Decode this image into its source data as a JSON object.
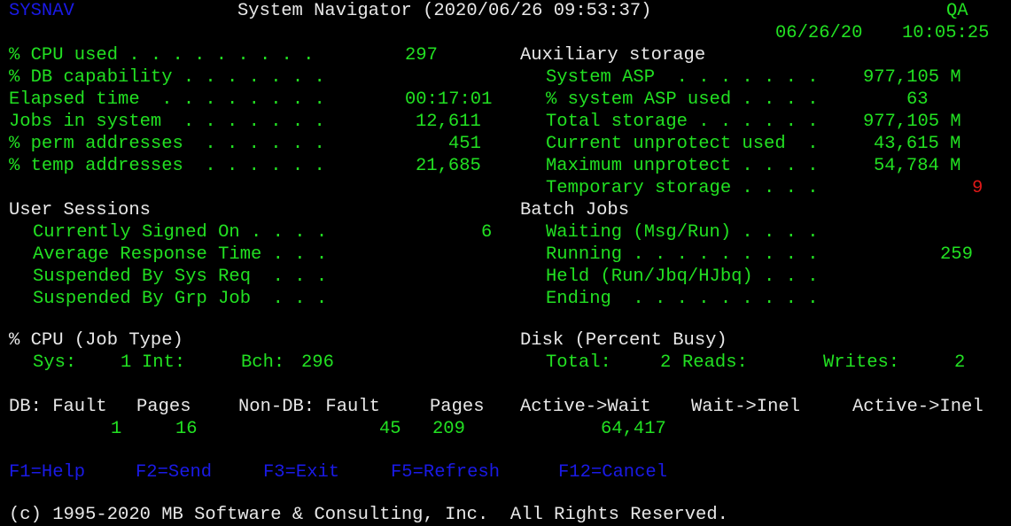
{
  "header": {
    "program_name": "SYSNAV",
    "title": "System Navigator (2020/06/26 09:53:37)",
    "system_name": "QA",
    "date": "06/26/20",
    "time": "10:05:25"
  },
  "system_stats": [
    {
      "label": "% CPU used . . . . . . . . .",
      "value": "297"
    },
    {
      "label": "% DB capability . . . . . . .",
      "value": ""
    },
    {
      "label": "Elapsed time  . . . . . . . .",
      "value": "00:17:01"
    },
    {
      "label": "Jobs in system  . . . . . . .",
      "value": "12,611"
    },
    {
      "label": "% perm addresses  . . . . . .",
      "value": "451"
    },
    {
      "label": "% temp addresses  . . . . . .",
      "value": "21,685"
    }
  ],
  "auxiliary_storage": {
    "heading": "Auxiliary storage",
    "items": [
      {
        "label": "System ASP  . . . . . . .",
        "value": "977,105 M"
      },
      {
        "label": "% system ASP used . . . .",
        "value": "63"
      },
      {
        "label": "Total storage . . . . . .",
        "value": "977,105 M"
      },
      {
        "label": "Current unprotect used  .",
        "value": "43,615 M"
      },
      {
        "label": "Maximum unprotect . . . .",
        "value": "54,784 M"
      },
      {
        "label": "Temporary storage . . . .",
        "value": "9"
      }
    ]
  },
  "user_sessions": {
    "heading": "User Sessions",
    "items": [
      {
        "label": "Currently Signed On . . . .",
        "value": "6"
      },
      {
        "label": "Average Response Time . . .",
        "value": ""
      },
      {
        "label": "Suspended By Sys Req  . . .",
        "value": ""
      },
      {
        "label": "Suspended By Grp Job  . . .",
        "value": ""
      }
    ]
  },
  "batch_jobs": {
    "heading": "Batch Jobs",
    "items": [
      {
        "label": "Waiting (Msg/Run) . . . .",
        "value": ""
      },
      {
        "label": "Running . . . . . . . . .",
        "value": "259"
      },
      {
        "label": "Held (Run/Jbq/HJbq) . . .",
        "value": ""
      },
      {
        "label": "Ending  . . . . . . . . .",
        "value": ""
      }
    ]
  },
  "cpu_job_type": {
    "heading": "% CPU (Job Type)",
    "sys_label": "Sys:",
    "sys_value": "1",
    "int_label": "Int:",
    "int_value": "",
    "bch_label": "Bch:",
    "bch_value": "296"
  },
  "disk_busy": {
    "heading": "Disk (Percent Busy)",
    "total_label": "Total:",
    "total_value": "2",
    "reads_label": "Reads:",
    "reads_value": "",
    "writes_label": "Writes:",
    "writes_value": "2"
  },
  "faults": {
    "headers": [
      "DB: Fault",
      "Pages",
      "Non-DB: Fault",
      "Pages",
      "Active->Wait",
      "Wait->Inel",
      "Active->Inel"
    ],
    "values": [
      "1",
      "16",
      "45",
      "209",
      "64,417",
      "",
      ""
    ]
  },
  "function_keys": [
    {
      "label": "F1=Help"
    },
    {
      "label": "F2=Send"
    },
    {
      "label": "F3=Exit"
    },
    {
      "label": "F5=Refresh"
    },
    {
      "label": "F12=Cancel"
    }
  ],
  "copyright": "(c) 1995-2020 MB Software & Consulting, Inc.  All Rights Reserved."
}
